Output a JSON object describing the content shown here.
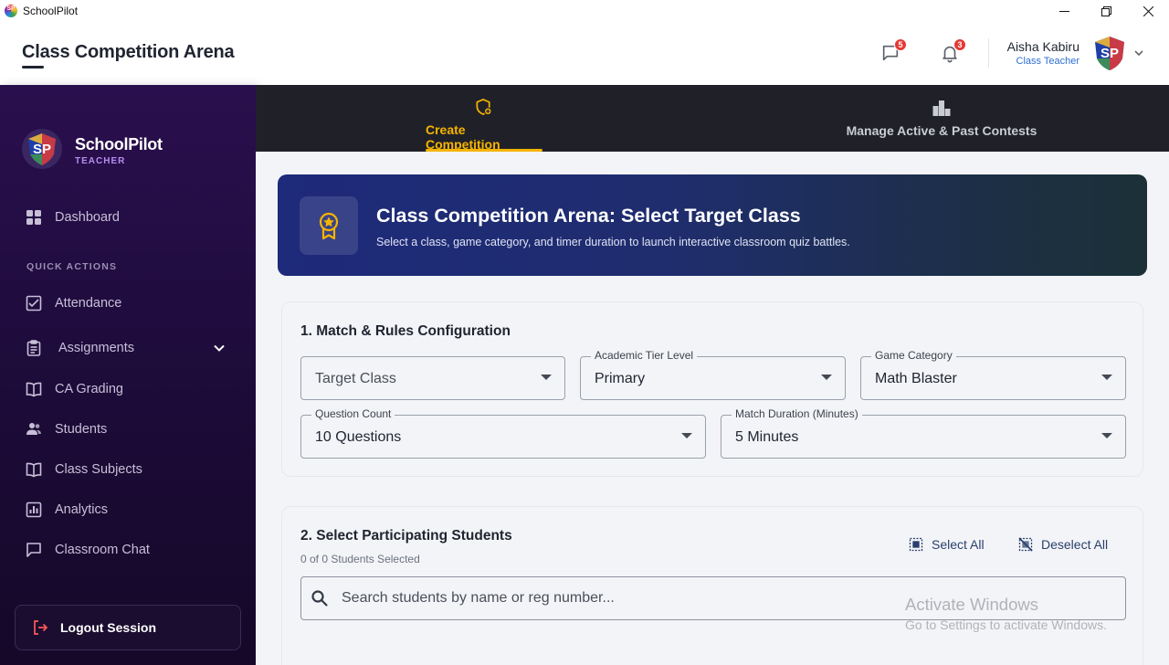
{
  "window": {
    "title": "SchoolPilot"
  },
  "header": {
    "page_title": "Class Competition Arena",
    "messages_count": "5",
    "notifications_count": "3",
    "user_name": "Aisha Kabiru",
    "user_role": "Class Teacher",
    "avatar_text": "SP"
  },
  "sidebar": {
    "brand_name": "SchoolPilot",
    "brand_sub": "TEACHER",
    "logo_text": "SP",
    "dashboard": "Dashboard",
    "section_label": "QUICK ACTIONS",
    "items": {
      "attendance": "Attendance",
      "assignments": "Assignments",
      "ca_grading": "CA Grading",
      "students": "Students",
      "class_subjects": "Class Subjects",
      "analytics": "Analytics",
      "classroom_chat": "Classroom Chat"
    },
    "logout": "Logout Session"
  },
  "tabs": {
    "create": "Create Competition",
    "manage": "Manage Active & Past Contests"
  },
  "hero": {
    "title": "Class Competition Arena: Select Target Class",
    "subtitle": "Select a class, game category, and timer duration to launch interactive classroom quiz battles."
  },
  "config": {
    "title": "1. Match & Rules Configuration",
    "target_class_placeholder": "Target Class",
    "tier_label": "Academic Tier Level",
    "tier_value": "Primary",
    "category_label": "Game Category",
    "category_value": "Math Blaster",
    "question_label": "Question Count",
    "question_value": "10 Questions",
    "duration_label": "Match Duration (Minutes)",
    "duration_value": "5 Minutes"
  },
  "students": {
    "title": "2. Select Participating Students",
    "selected_count": "0 of 0 Students Selected",
    "select_all": "Select All",
    "deselect_all": "Deselect All",
    "search_placeholder": "Search students by name or reg number..."
  },
  "watermark": {
    "line1": "Activate Windows",
    "line2": "Go to Settings to activate Windows."
  },
  "colors": {
    "accent": "#f5b400",
    "sidebar_top": "#2a0f4e",
    "hero_start": "#1e2a7a",
    "badge": "#e53935",
    "role_blue": "#2f6fd0"
  }
}
